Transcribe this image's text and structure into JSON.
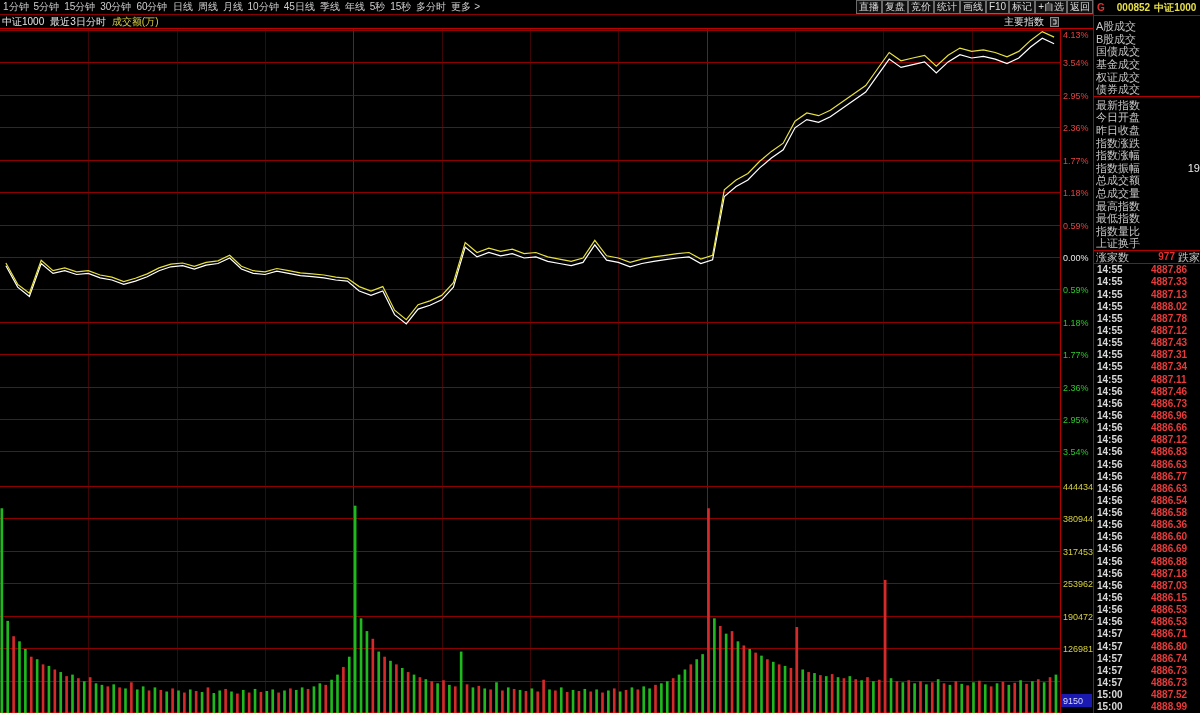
{
  "toolbar": {
    "periods": [
      "1分钟",
      "5分钟",
      "15分钟",
      "30分钟",
      "60分钟",
      "日线",
      "周线",
      "月线",
      "10分钟",
      "45日线",
      "季线",
      "年线",
      "5秒",
      "15秒",
      "多分时",
      "更多 >"
    ],
    "buttons": [
      "直播",
      "复盘",
      "竞价",
      "统计",
      "画线",
      "F10",
      "标记",
      "+自选",
      "返回"
    ]
  },
  "chart_header": {
    "index_name": "中证1000",
    "range": "最近3日分时",
    "indicator": "成交额(万)",
    "index_menu": "主要指数"
  },
  "price_chart": {
    "chart_data": {
      "type": "line",
      "grid": true,
      "ylim": [
        -3.86,
        4.13
      ],
      "yticks": [
        {
          "value": 4.13,
          "label": "4.13%"
        },
        {
          "value": 3.54,
          "label": "3.54%"
        },
        {
          "value": 2.95,
          "label": "2.95%"
        },
        {
          "value": 2.36,
          "label": "2.36%"
        },
        {
          "value": 1.77,
          "label": "1.77%"
        },
        {
          "value": 1.18,
          "label": "1.18%"
        },
        {
          "value": 0.59,
          "label": "0.59%"
        },
        {
          "value": 0,
          "label": "0.00%"
        },
        {
          "value": -0.59,
          "label": "0.59%"
        },
        {
          "value": -1.18,
          "label": "1.18%"
        },
        {
          "value": -1.77,
          "label": "1.77%"
        },
        {
          "value": -2.36,
          "label": "2.36%"
        },
        {
          "value": -2.95,
          "label": "2.95%"
        },
        {
          "value": -3.54,
          "label": "3.54%"
        }
      ],
      "series": [
        {
          "color": "#ffffff",
          "values": [
            -0.16,
            -0.55,
            -0.72,
            -0.12,
            -0.3,
            -0.25,
            -0.32,
            -0.3,
            -0.38,
            -0.42,
            -0.5,
            -0.44,
            -0.36,
            -0.25,
            -0.18,
            -0.16,
            -0.22,
            -0.15,
            -0.12,
            -0.02,
            -0.22,
            -0.3,
            -0.32,
            -0.26,
            -0.3,
            -0.34,
            -0.36,
            -0.38,
            -0.42,
            -0.44,
            -0.62,
            -0.7,
            -0.62,
            -1.05,
            -1.22,
            -0.95,
            -0.88,
            -0.78,
            -0.55,
            0.18,
            0.0,
            0.08,
            0.02,
            0.06,
            -0.02,
            0.0,
            -0.08,
            -0.12,
            -0.16,
            -0.1,
            0.22,
            -0.06,
            -0.1,
            -0.18,
            -0.12,
            -0.08,
            -0.05,
            -0.02,
            0.0,
            -0.12,
            -0.05,
            1.1,
            1.28,
            1.4,
            1.62,
            1.8,
            1.95,
            2.35,
            2.5,
            2.45,
            2.55,
            2.7,
            2.85,
            3.0,
            3.3,
            3.6,
            3.45,
            3.5,
            3.55,
            3.35,
            3.55,
            3.68,
            3.62,
            3.65,
            3.6,
            3.52,
            3.62,
            3.82,
            3.98,
            3.88
          ]
        },
        {
          "color": "#e6e040",
          "values": [
            -0.11,
            -0.5,
            -0.66,
            -0.06,
            -0.25,
            -0.2,
            -0.27,
            -0.25,
            -0.33,
            -0.37,
            -0.45,
            -0.39,
            -0.31,
            -0.2,
            -0.13,
            -0.11,
            -0.17,
            -0.1,
            -0.07,
            0.03,
            -0.17,
            -0.25,
            -0.27,
            -0.21,
            -0.25,
            -0.29,
            -0.31,
            -0.33,
            -0.37,
            -0.39,
            -0.54,
            -0.62,
            -0.54,
            -0.97,
            -1.14,
            -0.87,
            -0.8,
            -0.7,
            -0.47,
            0.26,
            0.08,
            0.16,
            0.1,
            0.14,
            0.06,
            0.08,
            0.0,
            -0.04,
            -0.08,
            -0.02,
            0.3,
            0.02,
            -0.02,
            -0.1,
            -0.04,
            0.0,
            0.03,
            0.06,
            0.08,
            -0.04,
            0.03,
            1.22,
            1.4,
            1.52,
            1.74,
            1.92,
            2.07,
            2.47,
            2.62,
            2.57,
            2.67,
            2.82,
            2.97,
            3.12,
            3.42,
            3.72,
            3.57,
            3.62,
            3.67,
            3.47,
            3.67,
            3.8,
            3.74,
            3.77,
            3.72,
            3.64,
            3.74,
            3.94,
            4.1,
            4.0
          ]
        }
      ]
    }
  },
  "volume_chart": {
    "chart_data": {
      "type": "bar",
      "grid": true,
      "ylim": [
        0,
        476700
      ],
      "yticks": [
        {
          "value": 444434,
          "label": "444434"
        },
        {
          "value": 380944,
          "label": "380944"
        },
        {
          "value": 317453,
          "label": "317453"
        },
        {
          "value": 253962,
          "label": "253962"
        },
        {
          "value": 190472,
          "label": "190472"
        },
        {
          "value": 126981,
          "label": "126981"
        }
      ],
      "series": [
        {
          "color": "#d42a2a",
          "values": [
            0,
            0,
            150000,
            0,
            0,
            110000,
            0,
            95000,
            0,
            85000,
            0,
            72000,
            0,
            68000,
            0,
            70000,
            0,
            0,
            52000,
            0,
            50000,
            0,
            60000,
            0,
            0,
            44000,
            0,
            45000,
            0,
            48000,
            0,
            40000,
            0,
            43000,
            0,
            50000,
            0,
            0,
            47000,
            0,
            38000,
            0,
            40000,
            0,
            41000,
            0,
            0,
            40000,
            0,
            48000,
            0,
            0,
            47000,
            0,
            0,
            55000,
            0,
            0,
            90000,
            0,
            0,
            0,
            0,
            145000,
            0,
            110000,
            0,
            95000,
            0,
            80000,
            0,
            70000,
            0,
            62000,
            0,
            64000,
            0,
            52000,
            0,
            56000,
            0,
            53000,
            0,
            46000,
            0,
            44000,
            0,
            47000,
            0,
            43000,
            0,
            42000,
            65000,
            0,
            44000,
            0,
            41000,
            0,
            43000,
            0,
            42000,
            0,
            40000,
            0,
            48000,
            0,
            45000,
            0,
            46000,
            0,
            0,
            55000,
            0,
            0,
            68000,
            0,
            0,
            95000,
            0,
            0,
            400000,
            0,
            170000,
            0,
            160000,
            0,
            132000,
            0,
            118000,
            0,
            105000,
            0,
            95000,
            0,
            88000,
            168000,
            0,
            80000,
            0,
            74000,
            0,
            76000,
            0,
            68000,
            0,
            66000,
            0,
            70000,
            0,
            65000,
            260000,
            0,
            62000,
            0,
            64000,
            0,
            62000,
            0,
            60000,
            0,
            58000,
            0,
            62000,
            0,
            54000,
            0,
            63000,
            0,
            52000,
            0,
            61000,
            0,
            59000,
            0,
            57000,
            0,
            66000,
            0,
            70000,
            0
          ]
        },
        {
          "color": "#1fb81f",
          "values": [
            400000,
            180000,
            0,
            140000,
            125000,
            0,
            105000,
            0,
            92000,
            0,
            80000,
            0,
            75000,
            0,
            62000,
            0,
            58000,
            55000,
            0,
            56000,
            0,
            48000,
            0,
            46000,
            52000,
            0,
            50000,
            0,
            42000,
            0,
            44000,
            0,
            46000,
            0,
            41000,
            0,
            39000,
            44000,
            0,
            42000,
            0,
            45000,
            0,
            47000,
            0,
            43000,
            46000,
            0,
            44000,
            0,
            45000,
            50000,
            0,
            52000,
            58000,
            0,
            65000,
            75000,
            0,
            110000,
            405000,
            185000,
            160000,
            0,
            120000,
            0,
            102000,
            0,
            88000,
            0,
            75000,
            0,
            66000,
            0,
            58000,
            0,
            55000,
            0,
            120000,
            0,
            50000,
            0,
            48000,
            0,
            60000,
            0,
            50000,
            0,
            45000,
            0,
            48000,
            0,
            0,
            46000,
            0,
            50000,
            0,
            45000,
            0,
            47000,
            0,
            46000,
            0,
            44000,
            0,
            42000,
            0,
            50000,
            0,
            52000,
            48000,
            0,
            58000,
            62000,
            0,
            75000,
            85000,
            0,
            105000,
            115000,
            0,
            185000,
            0,
            155000,
            0,
            140000,
            0,
            125000,
            0,
            112000,
            0,
            100000,
            0,
            92000,
            0,
            0,
            85000,
            0,
            78000,
            0,
            72000,
            0,
            70000,
            0,
            72000,
            0,
            64000,
            0,
            62000,
            0,
            0,
            68000,
            0,
            60000,
            0,
            58000,
            0,
            56000,
            0,
            66000,
            0,
            55000,
            0,
            57000,
            0,
            60000,
            0,
            56000,
            0,
            58000,
            0,
            55000,
            0,
            64000,
            0,
            62000,
            0,
            60000,
            0,
            75000
          ]
        }
      ]
    },
    "value_tag": "9150"
  },
  "quote_panel": {
    "flag": "G",
    "code": "000852",
    "name": "中证1000",
    "turnover": [
      {
        "label": "A股成交"
      },
      {
        "label": "B股成交"
      },
      {
        "label": "国债成交"
      },
      {
        "label": "基金成交"
      },
      {
        "label": "权证成交"
      },
      {
        "label": "债券成交"
      }
    ],
    "index_stats": [
      {
        "label": "最新指数"
      },
      {
        "label": "今日开盘"
      },
      {
        "label": "昨日收盘"
      },
      {
        "label": "指数涨跌"
      },
      {
        "label": "指数涨幅"
      },
      {
        "label": "指数振幅",
        "value": "19"
      },
      {
        "label": "总成交额"
      },
      {
        "label": "总成交量"
      },
      {
        "label": "最高指数"
      },
      {
        "label": "最低指数"
      },
      {
        "label": "指数量比"
      },
      {
        "label": "上证换手"
      }
    ],
    "breadth": {
      "up_label": "涨家数",
      "up_count": "977",
      "down_label": "跌家"
    },
    "ticks": [
      {
        "time": "14:55",
        "price": "4887.86"
      },
      {
        "time": "14:55",
        "price": "4887.33"
      },
      {
        "time": "14:55",
        "price": "4887.13"
      },
      {
        "time": "14:55",
        "price": "4888.02"
      },
      {
        "time": "14:55",
        "price": "4887.78"
      },
      {
        "time": "14:55",
        "price": "4887.12"
      },
      {
        "time": "14:55",
        "price": "4887.43"
      },
      {
        "time": "14:55",
        "price": "4887.31"
      },
      {
        "time": "14:55",
        "price": "4887.34"
      },
      {
        "time": "14:55",
        "price": "4887.11"
      },
      {
        "time": "14:56",
        "price": "4887.46"
      },
      {
        "time": "14:56",
        "price": "4886.73"
      },
      {
        "time": "14:56",
        "price": "4886.96"
      },
      {
        "time": "14:56",
        "price": "4886.66"
      },
      {
        "time": "14:56",
        "price": "4887.12"
      },
      {
        "time": "14:56",
        "price": "4886.83"
      },
      {
        "time": "14:56",
        "price": "4886.63"
      },
      {
        "time": "14:56",
        "price": "4886.77"
      },
      {
        "time": "14:56",
        "price": "4886.63"
      },
      {
        "time": "14:56",
        "price": "4886.54"
      },
      {
        "time": "14:56",
        "price": "4886.58"
      },
      {
        "time": "14:56",
        "price": "4886.36"
      },
      {
        "time": "14:56",
        "price": "4886.60"
      },
      {
        "time": "14:56",
        "price": "4886.69"
      },
      {
        "time": "14:56",
        "price": "4886.88"
      },
      {
        "time": "14:56",
        "price": "4887.18"
      },
      {
        "time": "14:56",
        "price": "4887.03"
      },
      {
        "time": "14:56",
        "price": "4886.15"
      },
      {
        "time": "14:56",
        "price": "4886.53"
      },
      {
        "time": "14:56",
        "price": "4886.53"
      },
      {
        "time": "14:57",
        "price": "4886.71"
      },
      {
        "time": "14:57",
        "price": "4886.80"
      },
      {
        "time": "14:57",
        "price": "4886.74"
      },
      {
        "time": "14:57",
        "price": "4886.73"
      },
      {
        "time": "14:57",
        "price": "4886.73"
      },
      {
        "time": "15:00",
        "price": "4887.52"
      },
      {
        "time": "15:00",
        "price": "4888.99"
      }
    ]
  }
}
